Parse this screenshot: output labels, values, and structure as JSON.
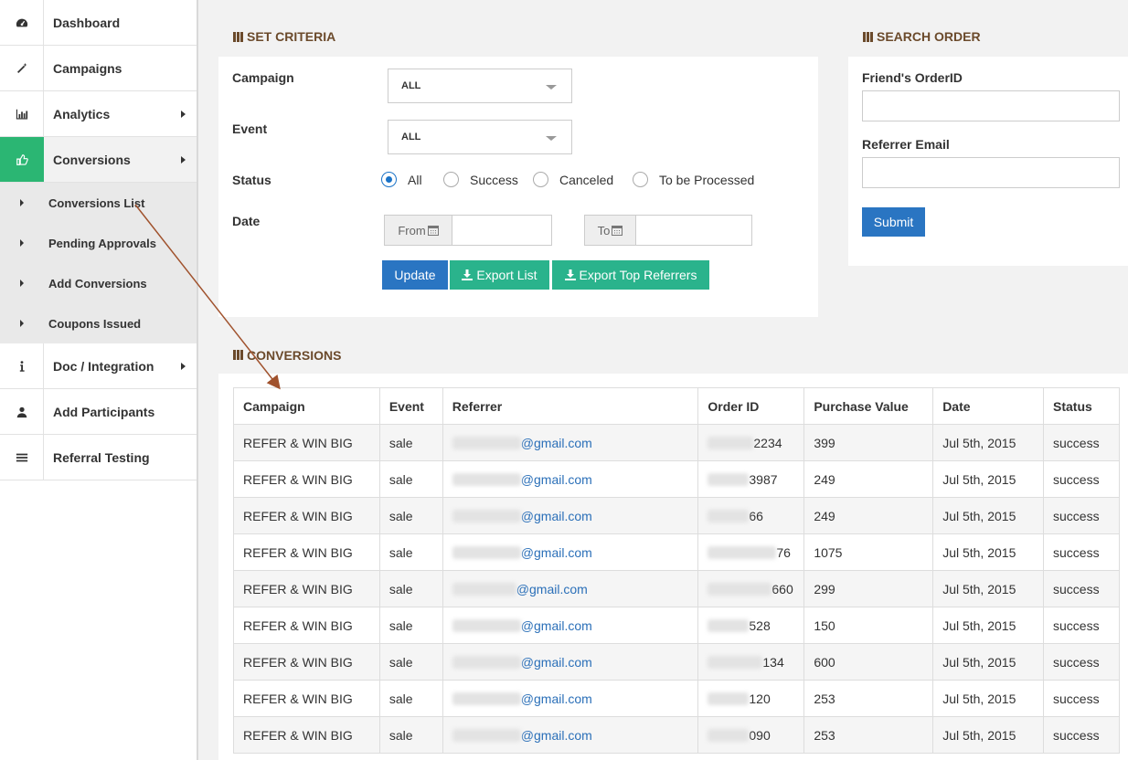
{
  "sidebar": {
    "items": [
      {
        "label": "Dashboard",
        "icon": "dashboard-icon"
      },
      {
        "label": "Campaigns",
        "icon": "wand-icon"
      },
      {
        "label": "Analytics",
        "icon": "bar-chart-icon"
      },
      {
        "label": "Conversions",
        "icon": "thumbs-up-icon"
      },
      {
        "label": "Doc / Integration",
        "icon": "info-icon"
      },
      {
        "label": "Add Participants",
        "icon": "user-icon"
      },
      {
        "label": "Referral Testing",
        "icon": "list-icon"
      }
    ],
    "conversions_sub": [
      "Conversions List",
      "Pending Approvals",
      "Add Conversions",
      "Coupons Issued"
    ]
  },
  "criteria": {
    "title": "SET CRITERIA",
    "campaign_label": "Campaign",
    "campaign_value": "ALL",
    "event_label": "Event",
    "event_value": "ALL",
    "status_label": "Status",
    "status_options": [
      "All",
      "Success",
      "Canceled",
      "To be Processed"
    ],
    "status_selected": "All",
    "date_label": "Date",
    "from_label": "From",
    "to_label": "To",
    "update_button": "Update",
    "export_list_button": "Export List",
    "export_top_button": "Export Top Referrers"
  },
  "search_order": {
    "title": "SEARCH ORDER",
    "friend_order_label": "Friend's OrderID",
    "referrer_email_label": "Referrer Email",
    "submit_button": "Submit"
  },
  "conversions": {
    "title": "CONVERSIONS",
    "columns": [
      "Campaign",
      "Event",
      "Referrer",
      "Order ID",
      "Purchase Value",
      "Date",
      "Status"
    ],
    "rows": [
      {
        "campaign": "REFER & WIN BIG",
        "event": "sale",
        "referrer": "@gmail.com",
        "order_id": "2234",
        "value": "399",
        "date": "Jul 5th, 2015",
        "status": "success"
      },
      {
        "campaign": "REFER & WIN BIG",
        "event": "sale",
        "referrer": "@gmail.com",
        "order_id": "3987",
        "value": "249",
        "date": "Jul 5th, 2015",
        "status": "success"
      },
      {
        "campaign": "REFER & WIN BIG",
        "event": "sale",
        "referrer": "@gmail.com",
        "order_id": "66",
        "value": "249",
        "date": "Jul 5th, 2015",
        "status": "success"
      },
      {
        "campaign": "REFER & WIN BIG",
        "event": "sale",
        "referrer": "@gmail.com",
        "order_id": "76",
        "value": "1075",
        "date": "Jul 5th, 2015",
        "status": "success"
      },
      {
        "campaign": "REFER & WIN BIG",
        "event": "sale",
        "referrer": "@gmail.com",
        "order_id": "660",
        "value": "299",
        "date": "Jul 5th, 2015",
        "status": "success"
      },
      {
        "campaign": "REFER & WIN BIG",
        "event": "sale",
        "referrer": "@gmail.com",
        "order_id": "528",
        "value": "150",
        "date": "Jul 5th, 2015",
        "status": "success"
      },
      {
        "campaign": "REFER & WIN BIG",
        "event": "sale",
        "referrer": "@gmail.com",
        "order_id": "134",
        "value": "600",
        "date": "Jul 5th, 2015",
        "status": "success"
      },
      {
        "campaign": "REFER & WIN BIG",
        "event": "sale",
        "referrer": "@gmail.com",
        "order_id": "120",
        "value": "253",
        "date": "Jul 5th, 2015",
        "status": "success"
      },
      {
        "campaign": "REFER & WIN BIG",
        "event": "sale",
        "referrer": "@gmail.com",
        "order_id": "090",
        "value": "253",
        "date": "Jul 5th, 2015",
        "status": "success"
      }
    ]
  },
  "colors": {
    "accent_green": "#2bb673",
    "button_blue": "#2a75c2",
    "button_teal": "#2ab38c",
    "heading_brown": "#6b4a2b",
    "annotation_arrow": "#a0522d"
  }
}
